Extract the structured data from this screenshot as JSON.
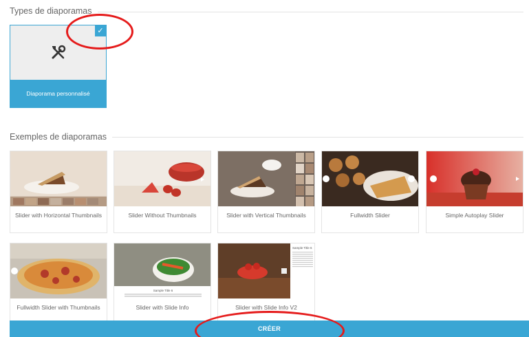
{
  "types_section": {
    "title": "Types de diaporamas",
    "card": {
      "label": "Diaporama personnalisé",
      "icon": "tools-icon",
      "selected": true,
      "check_icon": "checkmark-icon",
      "check_glyph": "✓"
    }
  },
  "examples_section": {
    "title": "Exemples de diaporamas",
    "items": [
      {
        "label": "Slider with Horizontal Thumbnails",
        "icon": "cake-photo"
      },
      {
        "label": "Slider Without Thumbnails",
        "icon": "strawberries-photo"
      },
      {
        "label": "Slider with Vertical Thumbnails",
        "icon": "cake-coffee-photo"
      },
      {
        "label": "Fullwidth Slider",
        "icon": "pastries-photo"
      },
      {
        "label": "Simple Autoplay Slider",
        "icon": "muffin-photo"
      },
      {
        "label": "Fullwidth Slider with Thumbnails",
        "icon": "pizza-photo"
      },
      {
        "label": "Slider with Slide Info",
        "icon": "salad-photo"
      },
      {
        "label": "Slider with Slide Info V2",
        "icon": "strawberry-bowl-photo"
      }
    ]
  },
  "thumb_captions": {
    "sample_title_card7": "Sample Title 6",
    "sample_title_card8": "Sample Title 6"
  },
  "create_button": {
    "label": "CRÉER"
  },
  "colors": {
    "accent": "#3aa6d4",
    "annotation": "#e51b1b"
  }
}
